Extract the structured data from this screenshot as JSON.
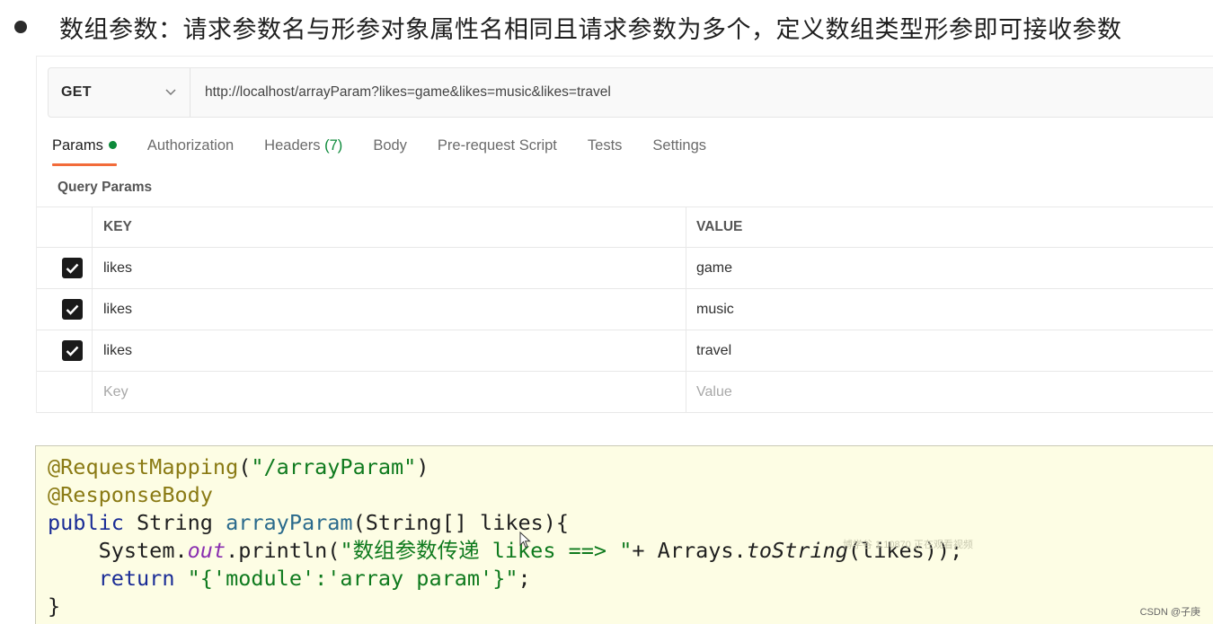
{
  "heading": "数组参数：请求参数名与形参对象属性名相同且请求参数为多个，定义数组类型形参即可接收参数",
  "request": {
    "method": "GET",
    "url": "http://localhost/arrayParam?likes=game&likes=music&likes=travel"
  },
  "tabs": [
    {
      "label": "Params",
      "active": true,
      "indicator": "green-dot"
    },
    {
      "label": "Authorization"
    },
    {
      "label": "Headers",
      "count": "(7)"
    },
    {
      "label": "Body"
    },
    {
      "label": "Pre-request Script"
    },
    {
      "label": "Tests"
    },
    {
      "label": "Settings"
    }
  ],
  "query_params": {
    "title": "Query Params",
    "columns": {
      "key": "KEY",
      "value": "VALUE"
    },
    "rows": [
      {
        "checked": true,
        "key": "likes",
        "value": "game"
      },
      {
        "checked": true,
        "key": "likes",
        "value": "music"
      },
      {
        "checked": true,
        "key": "likes",
        "value": "travel"
      }
    ],
    "placeholder": {
      "key": "Key",
      "value": "Value"
    }
  },
  "code": {
    "annotation1": "@RequestMapping",
    "annotation1_arg": "(\"/arrayParam\")",
    "annotation1_str": "\"/arrayParam\"",
    "annotation2": "@ResponseBody",
    "sig_kw": "public",
    "sig_type": " String ",
    "sig_name": "arrayParam",
    "sig_params": "(String[] likes){",
    "l4_indent": "    ",
    "l4_system": "System.",
    "l4_out": "out",
    "l4_println": ".println(",
    "l4_str": "\"数组参数传递 likes ==> \"",
    "l4_plus": "+ Arrays.",
    "l4_tostring": "toString",
    "l4_end": "(likes));",
    "l5_kw": "return",
    "l5_str": "\"{'module':'array param'}\"",
    "l5_end": ";",
    "l6": "}"
  },
  "watermark": "博学谷 1.10870 正在观看视频",
  "credit": "CSDN @子庚",
  "colors": {
    "tab_active_underline": "#f26b3a",
    "status_green": "#0c8a3a",
    "code_background": "#fdfde4"
  }
}
